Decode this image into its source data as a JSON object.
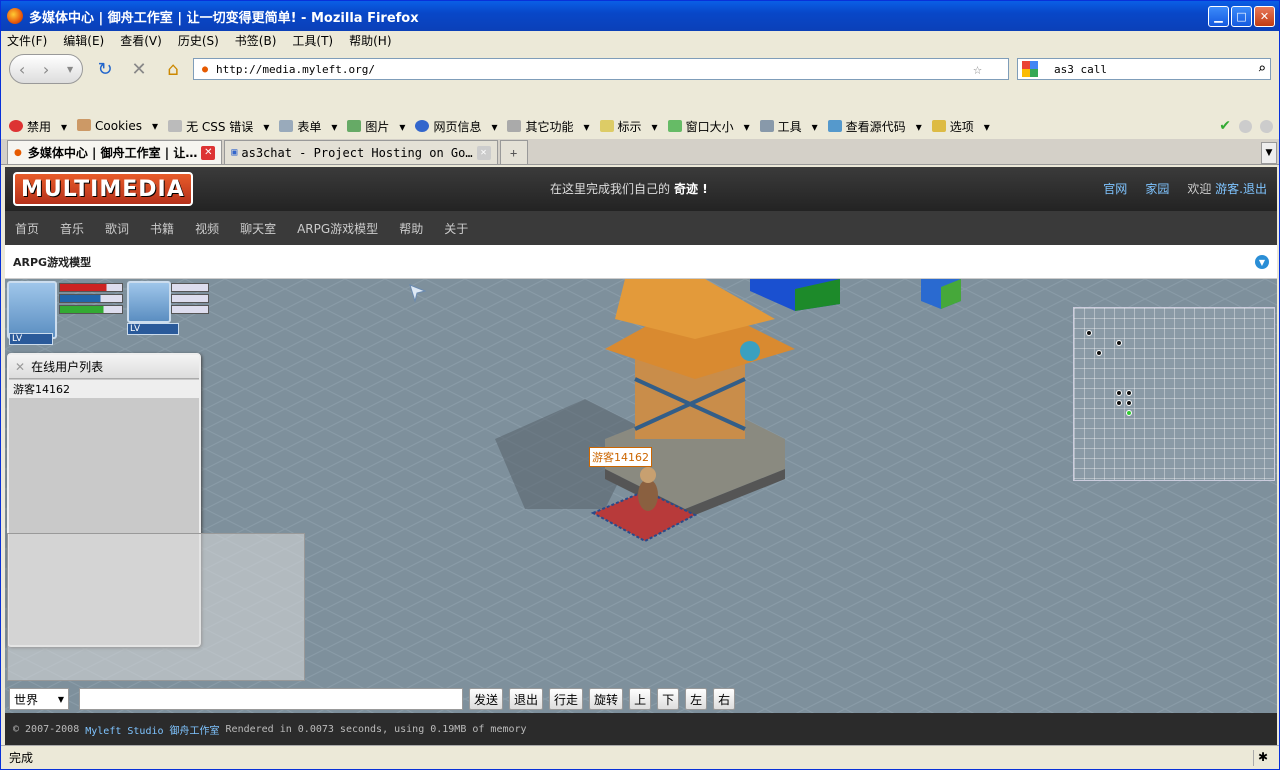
{
  "window": {
    "title": "多媒体中心 | 御舟工作室 | 让一切变得更简单! - Mozilla Firefox"
  },
  "menu": [
    "文件(F)",
    "编辑(E)",
    "查看(V)",
    "历史(S)",
    "书签(B)",
    "工具(T)",
    "帮助(H)"
  ],
  "address": {
    "url": "http://media.myleft.org/"
  },
  "search": {
    "value": "as3 call"
  },
  "devtoolbar": [
    "禁用",
    "Cookies",
    "无 CSS 错误",
    "表单",
    "图片",
    "网页信息",
    "其它功能",
    "标示",
    "窗口大小",
    "工具",
    "查看源代码",
    "选项"
  ],
  "tabs": [
    {
      "label": "多媒体中心 | 御舟工作室 | 让…"
    },
    {
      "label": "as3chat - Project Hosting on Go…"
    }
  ],
  "site": {
    "logo": "MULTIMEDIA",
    "slogan": "在这里完成我们自己的",
    "slogan_bold": "奇迹 !",
    "links": [
      "官网",
      "家园"
    ],
    "welcome": "欢迎",
    "user_link": "游客.退出",
    "nav": [
      "首页",
      "音乐",
      "歌词",
      "书籍",
      "视频",
      "聊天室",
      "ARPG游戏模型",
      "帮助",
      "关于"
    ],
    "page_title": "ARPG游戏模型",
    "footer_copy": "© 2007-2008",
    "footer_studio": "Myleft Studio 御舟工作室",
    "footer_render": "Rendered in 0.0073 seconds, using 0.19MB of memory"
  },
  "game": {
    "lv_label": "LV",
    "userlist_title": "在线用户列表",
    "users": [
      "游客14162"
    ],
    "player_name": "游客14162",
    "channel": "世界",
    "buttons": [
      "发送",
      "退出",
      "行走",
      "旋转",
      "上",
      "下",
      "左",
      "右"
    ],
    "colors": {
      "ground": "#7e909c",
      "hp": "#cc2222",
      "mp": "#2266aa",
      "exp": "#33aa33"
    }
  },
  "status": {
    "text": "完成"
  }
}
